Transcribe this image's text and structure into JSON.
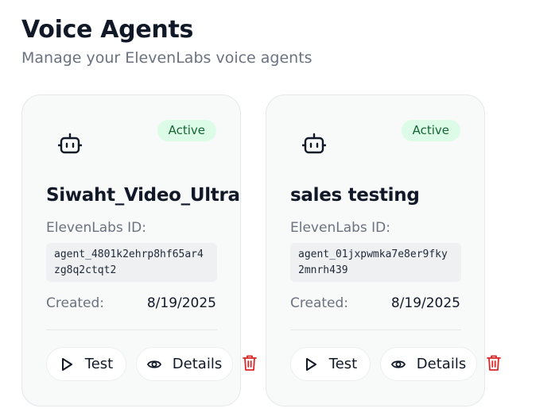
{
  "header": {
    "title": "Voice Agents",
    "subtitle": "Manage your ElevenLabs voice agents"
  },
  "agents": [
    {
      "name": "Siwaht_Video_Ultra",
      "status": "Active",
      "id_label": "ElevenLabs ID:",
      "id_value": "agent_4801k2ehrp8hf65ar4zg8q2ctqt2",
      "created_label": "Created:",
      "created_value": "8/19/2025",
      "test_label": "Test",
      "details_label": "Details",
      "icon": "robot-icon"
    },
    {
      "name": "sales testing",
      "status": "Active",
      "id_label": "ElevenLabs ID:",
      "id_value": "agent_01jxpwmka7e8er9fky2mnrh439",
      "created_label": "Created:",
      "created_value": "8/19/2025",
      "test_label": "Test",
      "details_label": "Details",
      "icon": "robot-icon"
    }
  ],
  "colors": {
    "badge_bg": "#dcfce7",
    "badge_text": "#166534",
    "delete": "#dc2626",
    "card_bg": "#f8f9f9"
  }
}
